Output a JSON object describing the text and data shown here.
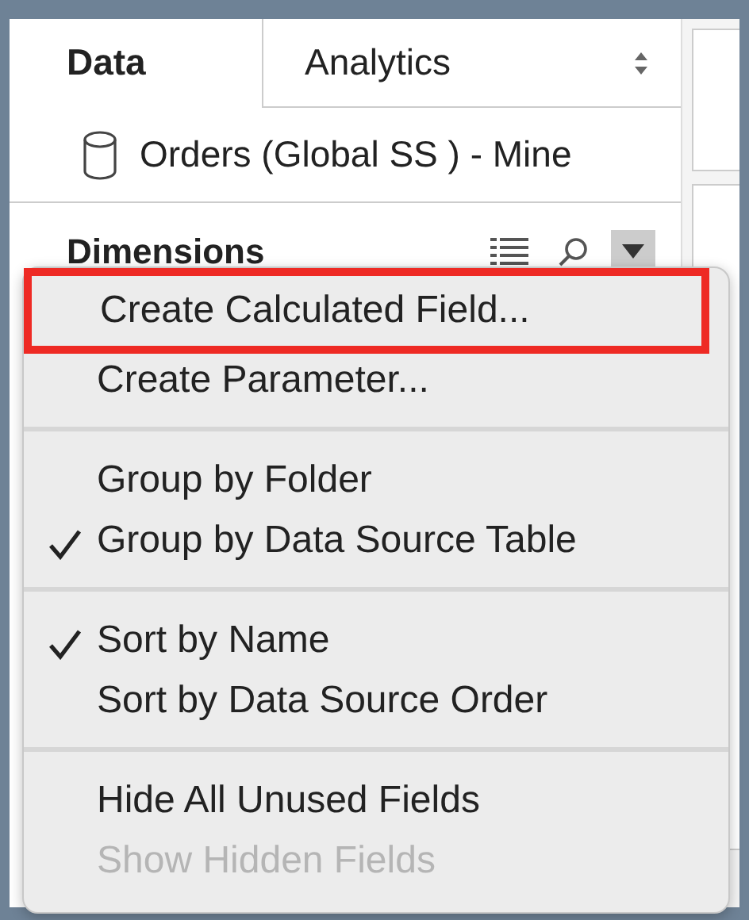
{
  "tabs": [
    {
      "label": "Data",
      "selected": true
    },
    {
      "label": "Analytics",
      "selected": false
    }
  ],
  "data_source": {
    "name": "Orders (Global SS ) - Mine"
  },
  "section": {
    "title": "Dimensions"
  },
  "menu": {
    "groups": [
      {
        "items": [
          {
            "label": "Create Calculated Field...",
            "checked": false,
            "disabled": false,
            "outlined": true
          },
          {
            "label": "Create Parameter...",
            "checked": false,
            "disabled": false,
            "outlined": false
          }
        ]
      },
      {
        "items": [
          {
            "label": "Group by Folder",
            "checked": false,
            "disabled": false,
            "outlined": false
          },
          {
            "label": "Group by Data Source Table",
            "checked": true,
            "disabled": false,
            "outlined": false
          }
        ]
      },
      {
        "items": [
          {
            "label": "Sort by Name",
            "checked": true,
            "disabled": false,
            "outlined": false
          },
          {
            "label": "Sort by Data Source Order",
            "checked": false,
            "disabled": false,
            "outlined": false
          }
        ]
      },
      {
        "items": [
          {
            "label": "Hide All Unused Fields",
            "checked": false,
            "disabled": false,
            "outlined": false
          },
          {
            "label": "Show Hidden Fields",
            "checked": false,
            "disabled": true,
            "outlined": false
          }
        ]
      }
    ]
  }
}
